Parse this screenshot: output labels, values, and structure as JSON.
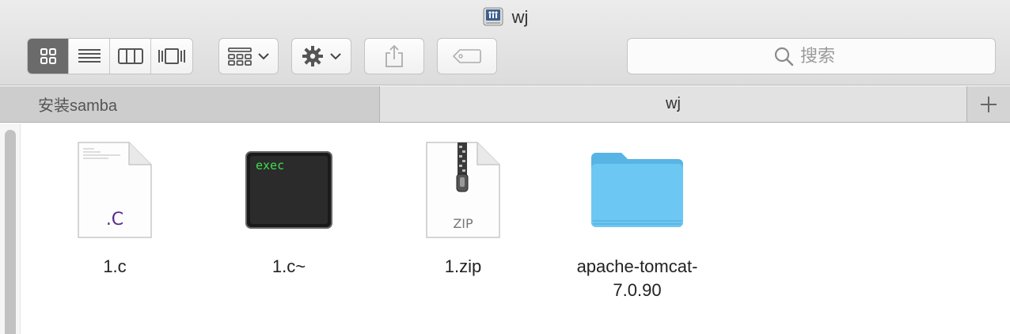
{
  "window": {
    "title": "wj"
  },
  "toolbar": {
    "view_icons": [
      "icon-view-icon",
      "list-view-icon",
      "column-view-icon",
      "cover-flow-view-icon"
    ],
    "search_placeholder": "搜索"
  },
  "tabs": [
    {
      "label": "安装samba",
      "active": false
    },
    {
      "label": "wj",
      "active": true
    }
  ],
  "files": [
    {
      "name": "1.c",
      "type": "c-source",
      "badge": ".C"
    },
    {
      "name": "1.c~",
      "type": "exec",
      "badge": "exec"
    },
    {
      "name": "1.zip",
      "type": "zip",
      "badge": "ZIP"
    },
    {
      "name": "apache-tomcat-7.0.90",
      "type": "folder",
      "badge": ""
    }
  ],
  "colors": {
    "active_view": "#6b6b6b",
    "folder": "#6cc7f2",
    "c_badge": "#5b2a8a",
    "exec_text": "#3ee04f"
  }
}
